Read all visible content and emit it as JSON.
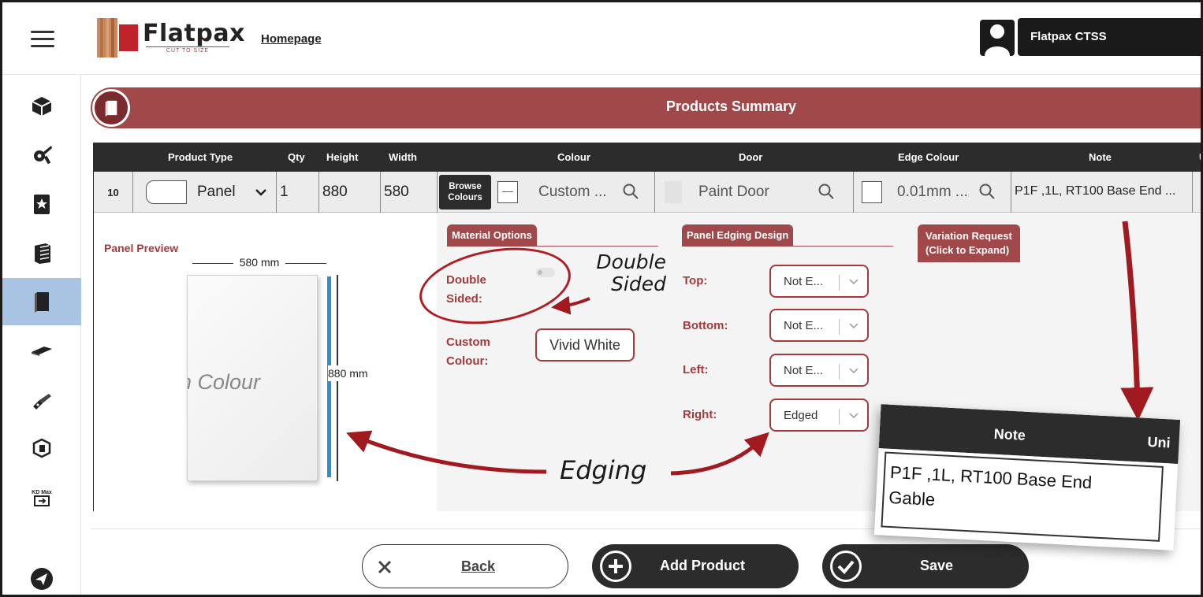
{
  "header": {
    "logo_text": "Flatpax",
    "logo_subtext": "CUT TO SIZE",
    "homepage_link": "Homepage",
    "user_name": "Flatpax CTSS"
  },
  "sidebar": {
    "items": [
      {
        "icon": "box-icon",
        "active": false
      },
      {
        "icon": "settings-tools-icon",
        "active": false
      },
      {
        "icon": "bookmark-star-icon",
        "active": false
      },
      {
        "icon": "cabinet-icon",
        "active": false
      },
      {
        "icon": "panel-icon",
        "active": true
      },
      {
        "icon": "benchtop-icon",
        "active": false
      },
      {
        "icon": "hinge-icon",
        "active": false
      },
      {
        "icon": "3d-box-icon",
        "active": false
      },
      {
        "icon": "kd-max-icon",
        "active": false,
        "label": "KD Max"
      },
      {
        "icon": "send-icon",
        "active": false
      }
    ]
  },
  "summary": {
    "title": "Products Summary"
  },
  "table": {
    "headers": {
      "product_type": "Product Type",
      "qty": "Qty",
      "height": "Height",
      "width": "Width",
      "colour": "Colour",
      "door": "Door",
      "edge_colour": "Edge Colour",
      "note": "Note",
      "unit_cut": "U"
    },
    "row": {
      "row_number": "10",
      "product_type": "Panel",
      "qty": "1",
      "height": "880",
      "width": "580",
      "browse_colours": "Browse Colours",
      "colour": "Custom ...",
      "door": "Paint Door",
      "edge_colour": "0.01mm ...",
      "note": "P1F ,1L, RT100 Base End ..."
    }
  },
  "panel_preview": {
    "title": "Panel Preview",
    "width_label": "580 mm",
    "height_label": "880 mm",
    "panel_label": "tom Colour"
  },
  "material_options": {
    "tab": "Material Options",
    "double_sided_label": "Double Sided:",
    "double_sided": false,
    "custom_colour_label": "Custom Colour:",
    "custom_colour_value": "Vivid White"
  },
  "panel_edging": {
    "tab": "Panel Edging Design",
    "top_label": "Top:",
    "top_value": "Not E...",
    "bottom_label": "Bottom:",
    "bottom_value": "Not E...",
    "left_label": "Left:",
    "left_value": "Not E...",
    "right_label": "Right:",
    "right_value": "Edged"
  },
  "variation_request": {
    "tab_line1": "Variation Request",
    "tab_line2": "(Click to Expand)"
  },
  "buttons": {
    "back": "Back",
    "add_product": "Add Product",
    "save": "Save"
  },
  "annotations": {
    "double_sided_line1": "Double",
    "double_sided_line2": "Sided",
    "edging": "Edging"
  },
  "callout": {
    "header": "Note",
    "header_right": "Uni",
    "note_line1": "P1F ,1L, RT100 Base End",
    "note_line2": "Gable"
  },
  "colors": {
    "brand_red": "#a0484a",
    "dark": "#2c2c2c",
    "accent_blue": "#2b8fd4",
    "active_nav": "#a9c4e2",
    "annotation_red": "#b01c22"
  }
}
